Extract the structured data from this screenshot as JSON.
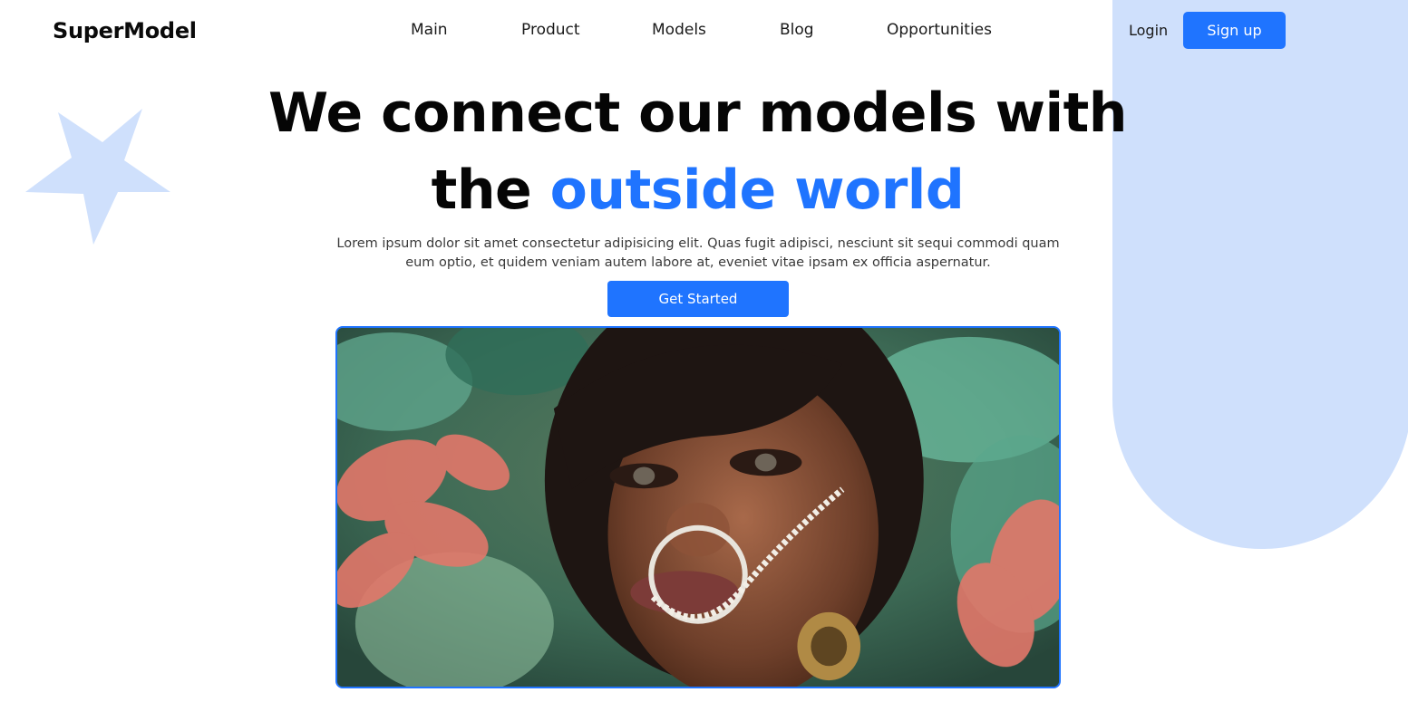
{
  "brand": {
    "name": "SuperModel"
  },
  "nav": {
    "items": [
      {
        "label": "Main"
      },
      {
        "label": "Product"
      },
      {
        "label": "Models"
      },
      {
        "label": "Blog"
      },
      {
        "label": "Opportunities"
      }
    ],
    "login_label": "Login",
    "signup_label": "Sign up"
  },
  "hero": {
    "title_line1": "We connect our models with",
    "title_line2_prefix": "the ",
    "title_line2_accent": "outside world",
    "description": "Lorem ipsum dolor sit amet consectetur adipisicing elit. Quas fugit adipisci, nesciunt sit sequi commodi quam eum optio, et quidem veniam autem labore at, eveniet vitae ipsam ex officia aspernatur.",
    "cta_label": "Get Started"
  },
  "theme": {
    "accent": "#1f74ff",
    "decor": "#cfe0fc"
  },
  "icons": {
    "decor_shape": "star-icon"
  }
}
